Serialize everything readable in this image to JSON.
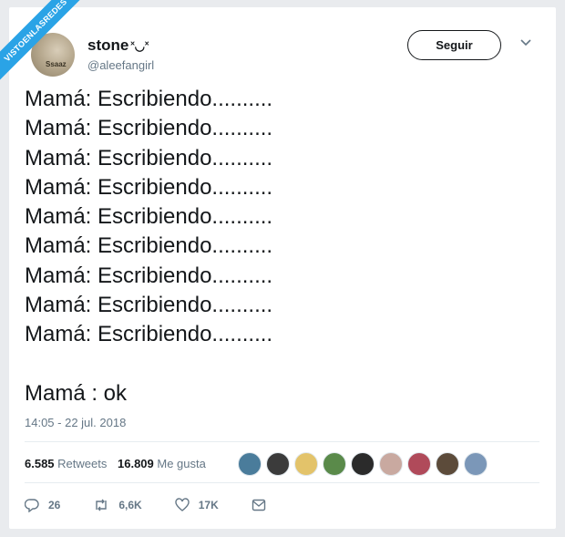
{
  "watermark": "VISTOENLASREDES",
  "author": {
    "name": "stone",
    "name_emoji": "˟◡˟",
    "handle": "@aleefangirl",
    "avatar_text": "Ssaaz"
  },
  "follow_label": "Seguir",
  "tweet": {
    "lines": [
      "Mamá: Escribiendo..........",
      "Mamá: Escribiendo..........",
      "Mamá: Escribiendo..........",
      "Mamá: Escribiendo..........",
      "Mamá: Escribiendo..........",
      "Mamá: Escribiendo..........",
      "Mamá: Escribiendo..........",
      "Mamá: Escribiendo..........",
      "Mamá: Escribiendo.........."
    ],
    "final_line": "Mamá : ok",
    "timestamp": "14:05 - 22 jul. 2018"
  },
  "stats": {
    "retweets_count": "6.585",
    "retweets_label": "Retweets",
    "likes_count": "16.809",
    "likes_label": "Me gusta"
  },
  "liker_colors": [
    "#4a7c9b",
    "#3b3b3b",
    "#e3c36a",
    "#5a8a4a",
    "#2b2b2b",
    "#c9a9a0",
    "#b04a5a",
    "#5c4b3a",
    "#7b97b8"
  ],
  "actions": {
    "replies": "26",
    "retweets": "6,6K",
    "likes": "17K"
  }
}
